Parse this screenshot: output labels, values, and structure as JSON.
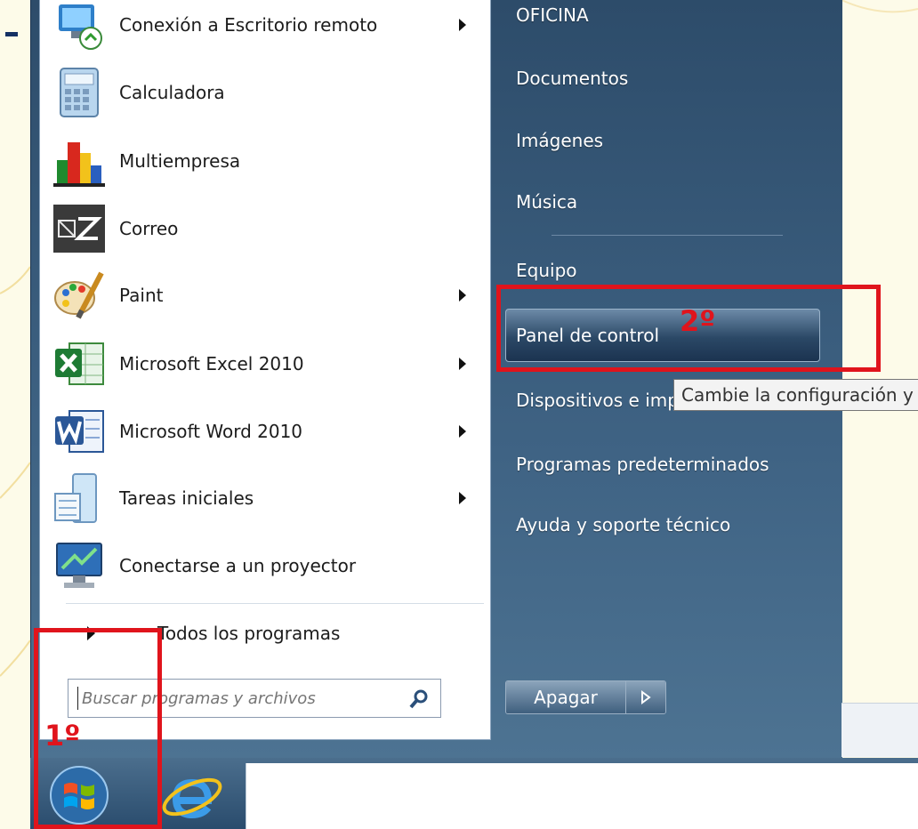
{
  "programs": [
    {
      "label": "Conexión a Escritorio remoto",
      "icon": "remote-desktop-icon",
      "submenu": true
    },
    {
      "label": "Calculadora",
      "icon": "calculator-icon",
      "submenu": false
    },
    {
      "label": "Multiempresa",
      "icon": "multiempresa-icon",
      "submenu": false
    },
    {
      "label": "Correo",
      "icon": "mail-icon",
      "submenu": false
    },
    {
      "label": "Paint",
      "icon": "paint-icon",
      "submenu": true
    },
    {
      "label": "Microsoft Excel 2010",
      "icon": "excel-icon",
      "submenu": true
    },
    {
      "label": "Microsoft Word 2010",
      "icon": "word-icon",
      "submenu": true
    },
    {
      "label": "Tareas iniciales",
      "icon": "getting-started-icon",
      "submenu": true
    },
    {
      "label": "Conectarse a un proyector",
      "icon": "projector-icon",
      "submenu": false
    }
  ],
  "all_programs_label": "Todos los programas",
  "search": {
    "placeholder": "Buscar programas y archivos"
  },
  "right_items": {
    "user": "OFICINA",
    "documents": "Documentos",
    "pictures": "Imágenes",
    "music": "Música",
    "computer": "Equipo",
    "control_panel": "Panel de control",
    "devices": "Dispositivos e impresoras",
    "default_programs": "Programas predeterminados",
    "help": "Ayuda y soporte técnico"
  },
  "tooltip": "Cambie la configuración y",
  "shutdown_label": "Apagar",
  "annotations": {
    "step1": "1º",
    "step2": "2º"
  },
  "colors": {
    "annotation_red": "#e0141c",
    "menu_blue": "#3f6384"
  }
}
